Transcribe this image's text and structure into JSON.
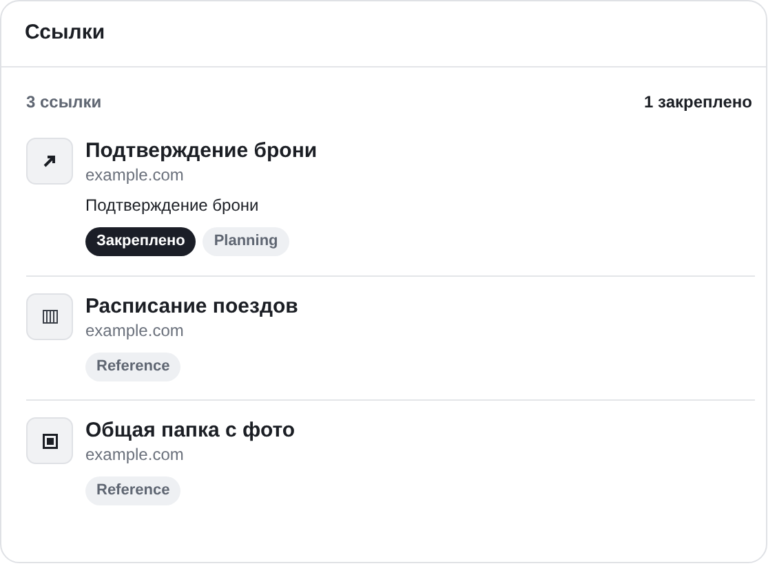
{
  "panel": {
    "title": "Ссылки"
  },
  "summary": {
    "count": "3 ссылки",
    "pinned": "1 закреплено"
  },
  "links": [
    {
      "kind": "arrow",
      "title": "Подтверждение брони",
      "domain": "example.com",
      "note": "Подтверждение брони",
      "tags": [
        {
          "label": "Закреплено",
          "kind": "pinned"
        },
        {
          "label": "Planning",
          "kind": "plain"
        }
      ]
    },
    {
      "kind": "barcode",
      "title": "Расписание поездов",
      "domain": "example.com",
      "tags": [
        {
          "label": "Reference",
          "kind": "plain"
        }
      ]
    },
    {
      "kind": "square",
      "title": "Общая папка с фото",
      "domain": "example.com",
      "tags": [
        {
          "label": "Reference",
          "kind": "plain"
        }
      ]
    }
  ]
}
